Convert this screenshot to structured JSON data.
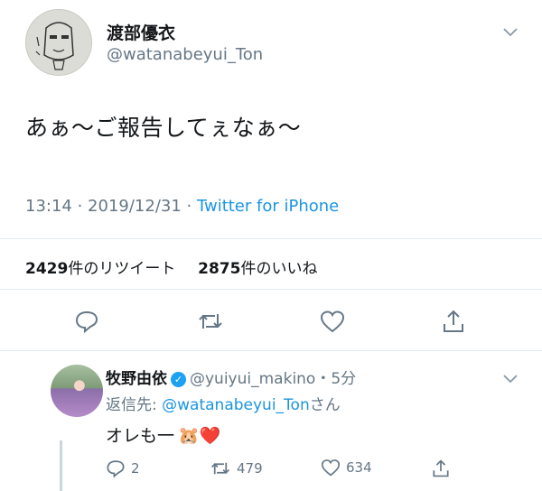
{
  "tweet": {
    "display_name": "渡部優衣",
    "handle": "@watanabeyui_Ton",
    "text": "あぁ～ご報告してぇなぁ～",
    "time": "13:14 · 2019/12/31 · ",
    "source": "Twitter for iPhone",
    "retweet_count": "2429",
    "retweet_label": "件のリツイート",
    "like_count": "2875",
    "like_label": "件のいいね"
  },
  "reply": {
    "display_name": "牧野由依",
    "handle": "@yuiyui_makino",
    "age": "・5分",
    "reply_prefix": "返信先: ",
    "reply_to": "@watanabeyui_Ton",
    "reply_suffix": "さん",
    "text": "オレも一",
    "emoji": "🐹❤️",
    "reply_count": "2",
    "retweet_count": "479",
    "like_count": "634"
  },
  "icons": [
    "chevron-down-icon",
    "reply-icon",
    "retweet-icon",
    "like-icon",
    "share-icon",
    "verified-icon"
  ],
  "colors": {
    "link": "#1b95e0",
    "secondary": "#657786",
    "divider": "#e1e8ed",
    "verified": "#1da1f2"
  }
}
